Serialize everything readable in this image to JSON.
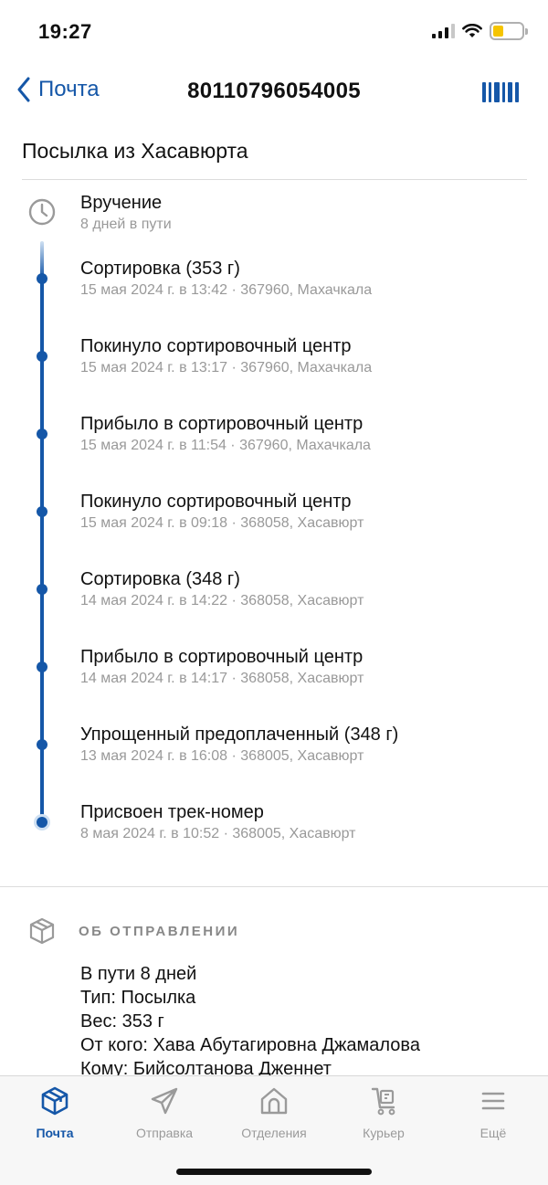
{
  "status_bar": {
    "time": "19:27"
  },
  "nav": {
    "back_label": "Почта",
    "title": "80110796054005"
  },
  "parcel_title": "Посылка из Хасавюрта",
  "current_status": {
    "title": "Вручение",
    "subtitle": "8 дней в пути"
  },
  "events": [
    {
      "title": "Сортировка  (353 г)",
      "subtitle": "15 мая 2024 г. в 13:42 · 367960, Махачкала"
    },
    {
      "title": "Покинуло сортировочный центр",
      "subtitle": "15 мая 2024 г. в 13:17 · 367960, Махачкала"
    },
    {
      "title": "Прибыло в сортировочный центр",
      "subtitle": "15 мая 2024 г. в 11:54 · 367960, Махачкала"
    },
    {
      "title": "Покинуло сортировочный центр",
      "subtitle": "15 мая 2024 г. в 09:18 · 368058, Хасавюрт"
    },
    {
      "title": "Сортировка  (348 г)",
      "subtitle": "14 мая 2024 г. в 14:22 · 368058, Хасавюрт"
    },
    {
      "title": "Прибыло в сортировочный центр",
      "subtitle": "14 мая 2024 г. в 14:17 · 368058, Хасавюрт"
    },
    {
      "title": "Упрощенный предоплаченный  (348 г)",
      "subtitle": "13 мая 2024 г. в 16:08 · 368005, Хасавюрт"
    },
    {
      "title": "Присвоен трек-номер",
      "subtitle": "8 мая 2024 г. в 10:52 · 368005, Хасавюрт"
    }
  ],
  "about": {
    "heading": "ОБ ОТПРАВЛЕНИИ",
    "lines": [
      "В пути 8 дней",
      "Тип: Посылка",
      "Вес: 353 г",
      "От кого: Хава Абутагировна Джамалова",
      "Кому: Бийсолтанова Дженнет"
    ]
  },
  "tabs": [
    {
      "label": "Почта",
      "icon": "parcel-box-icon",
      "active": true
    },
    {
      "label": "Отправка",
      "icon": "paper-plane-icon",
      "active": false
    },
    {
      "label": "Отделения",
      "icon": "post-office-icon",
      "active": false
    },
    {
      "label": "Курьер",
      "icon": "courier-cart-icon",
      "active": false
    },
    {
      "label": "Ещё",
      "icon": "menu-icon",
      "active": false
    }
  ],
  "colors": {
    "accent": "#1557a8",
    "muted_text": "#999999",
    "tab_inactive": "#9a9a9a"
  }
}
